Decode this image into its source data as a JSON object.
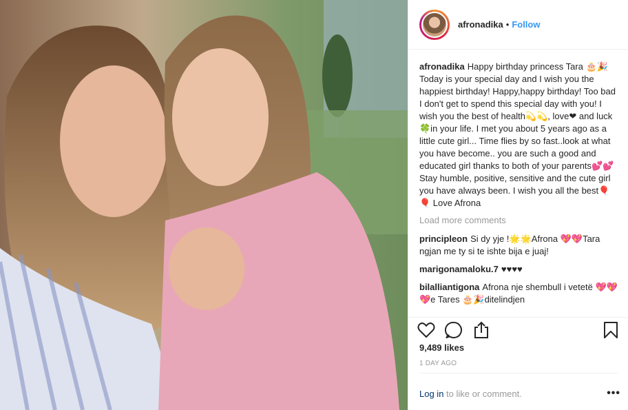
{
  "header": {
    "username": "afronadika",
    "separator": "•",
    "follow_label": "Follow"
  },
  "caption": {
    "username": "afronadika",
    "text": "Happy birthday princess Tara 🎂🎉 Today is your special day and I wish you the happiest birthday! Happy,happy birthday! Too bad I don't get to spend this special day with you! I wish you the best of health💫💫, love❤ and luck 🍀in your life. I met you about 5 years ago as a little cute girl... Time flies by so fast..look at what you have become.. you are such a good and educated girl thanks to both of your parents💕💕Stay humble, positive, sensitive and the cute girl you have always been. I wish you all the best🎈🎈 Love Afrona"
  },
  "load_more_label": "Load more comments",
  "comments": [
    {
      "username": "principleon",
      "text": "Si dy yje !🌟🌟Afrona 💖💖Tara ngjan me ty si te ishte bija e juaj!"
    },
    {
      "username": "marigonamaloku.7",
      "text": "♥♥♥♥"
    },
    {
      "username": "bilalliantigona",
      "text": "Afrona nje shembull i vetetë 💖💖💖e Tares 🎂🎉ditelindjen"
    }
  ],
  "actions": {
    "like_icon": "heart-icon",
    "comment_icon": "comment-icon",
    "share_icon": "share-icon",
    "save_icon": "bookmark-icon"
  },
  "likes": "9,489 likes",
  "timestamp": "1 DAY AGO",
  "footer": {
    "login_link": "Log in",
    "login_text": " to like or comment.",
    "more_label": "•••"
  },
  "colors": {
    "link_blue": "#3897f0",
    "muted_gray": "#999999"
  }
}
